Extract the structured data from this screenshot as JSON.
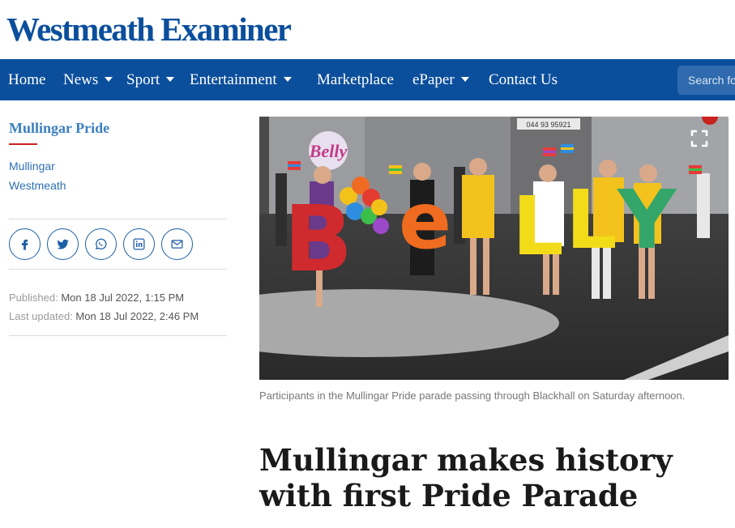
{
  "site": {
    "name": "Westmeath Examiner"
  },
  "nav": {
    "items": [
      {
        "label": "Home",
        "dropdown": false
      },
      {
        "label": "News",
        "dropdown": true
      },
      {
        "label": "Sport",
        "dropdown": true
      },
      {
        "label": "Entertainment",
        "dropdown": true
      },
      {
        "label": "Marketplace",
        "dropdown": false
      },
      {
        "label": "ePaper",
        "dropdown": true
      },
      {
        "label": "Contact Us",
        "dropdown": false
      }
    ],
    "search_placeholder": "Search for"
  },
  "sidebar": {
    "tag_title": "Mullingar Pride",
    "tags": [
      "Mullingar",
      "Westmeath"
    ],
    "share_icons": [
      "facebook-icon",
      "twitter-icon",
      "whatsapp-icon",
      "linkedin-icon",
      "email-icon"
    ],
    "published_label": "Published:",
    "published_value": "Mon 18 Jul 2022, 1:15 PM",
    "updated_label": "Last updated:",
    "updated_value": "Mon 18 Jul 2022, 2:46 PM"
  },
  "article": {
    "caption": "Participants in the Mullingar Pride parade passing through Blackhall on Saturday afternoon.",
    "headline": "Mullingar makes history with first Pride Parade",
    "photo_letters": [
      "B",
      "e",
      "L",
      "L",
      "Y"
    ],
    "shopfront_number": "044 93 95921"
  },
  "colors": {
    "brand_blue": "#0b4f9c",
    "link_blue": "#2d6fb3",
    "accent_red": "#c8231f"
  }
}
